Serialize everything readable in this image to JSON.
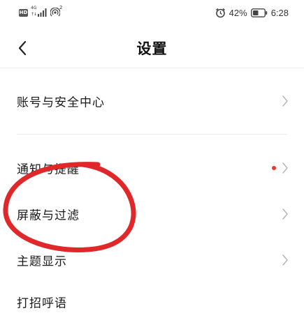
{
  "status_bar": {
    "hd_badge": "HD",
    "network_type": "4G",
    "data_arrows": "↑↓",
    "hotspot_count": "2",
    "battery_percent": "42%",
    "time": "6:28"
  },
  "header": {
    "title": "设置"
  },
  "menu": {
    "items": [
      {
        "label": "账号与安全中心",
        "has_dot": false
      },
      {
        "label": "通知与提醒",
        "has_dot": true
      },
      {
        "label": "屏蔽与过滤",
        "has_dot": false
      },
      {
        "label": "主题显示",
        "has_dot": false
      },
      {
        "label": "打招呼语",
        "has_dot": false
      }
    ]
  },
  "colors": {
    "accent_dot": "#e8382e",
    "annotation": "#e0282a",
    "divider": "#ececec"
  },
  "icons": {
    "back": "back-arrow-icon",
    "chevron": "chevron-right-icon",
    "alarm": "alarm-icon",
    "battery": "battery-icon",
    "signal": "signal-icon",
    "hotspot": "hotspot-icon"
  }
}
